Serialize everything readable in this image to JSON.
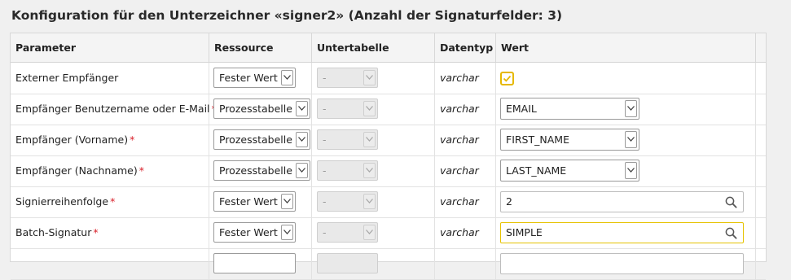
{
  "title": "Konfiguration für den Unterzeichner «signer2» (Anzahl der Signaturfelder: 3)",
  "columns": {
    "parameter": "Parameter",
    "ressource": "Ressource",
    "untertabelle": "Untertabelle",
    "datentyp": "Datentyp",
    "wert": "Wert"
  },
  "required_marker": "*",
  "rows": [
    {
      "parameter": "Externer Empfänger",
      "ressource": "Fester Wert",
      "untertabelle": "-",
      "datentyp": "varchar",
      "wert": "",
      "wert_checked": true
    },
    {
      "parameter": "Empfänger Benutzername oder E-Mail",
      "ressource": "Prozesstabelle",
      "untertabelle": "-",
      "datentyp": "varchar",
      "wert": "EMAIL"
    },
    {
      "parameter": "Empfänger (Vorname)",
      "ressource": "Prozesstabelle",
      "untertabelle": "-",
      "datentyp": "varchar",
      "wert": "FIRST_NAME"
    },
    {
      "parameter": "Empfänger (Nachname)",
      "ressource": "Prozesstabelle",
      "untertabelle": "-",
      "datentyp": "varchar",
      "wert": "LAST_NAME"
    },
    {
      "parameter": "Signierreihenfolge",
      "ressource": "Fester Wert",
      "untertabelle": "-",
      "datentyp": "varchar",
      "wert": "2"
    },
    {
      "parameter": "Batch-Signatur",
      "ressource": "Fester Wert",
      "untertabelle": "-",
      "datentyp": "varchar",
      "wert": "SIMPLE"
    }
  ],
  "icons": {
    "dropdown": "chevron-down-icon",
    "search": "magnifier-icon",
    "check": "checkmark-icon"
  },
  "colors": {
    "required": "#d9202a",
    "checkbox_border": "#e6b800",
    "focus_border": "#e6c200"
  }
}
